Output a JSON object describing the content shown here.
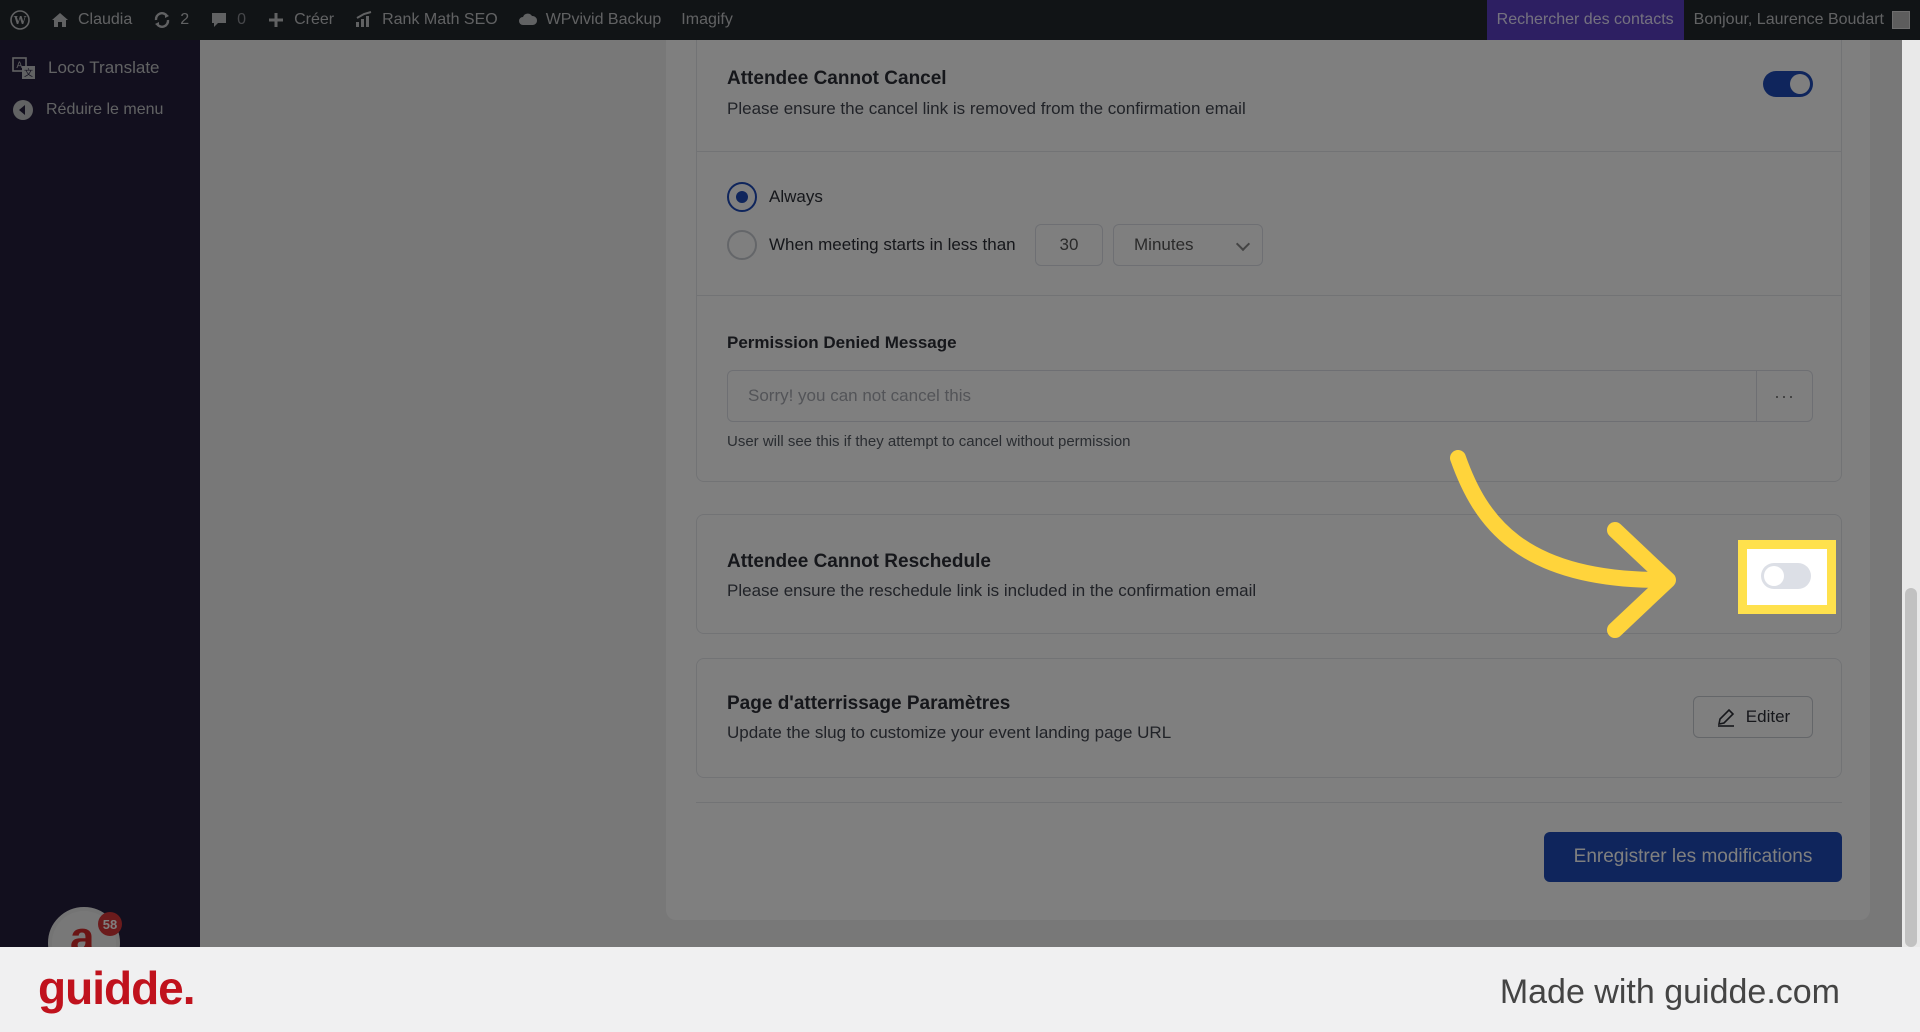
{
  "admin_bar": {
    "site_name": "Claudia",
    "updates_count": "2",
    "comments_count": "0",
    "create_label": "Créer",
    "rank_math_label": "Rank Math SEO",
    "backup_label": "WPvivid Backup",
    "imagify_label": "Imagify",
    "search_contacts_label": "Rechercher des contacts",
    "greeting": "Bonjour, Laurence Boudart"
  },
  "sidebar": {
    "items": [
      {
        "label": "Loco Translate",
        "icon": "translate-icon"
      },
      {
        "label": "Réduire le menu",
        "icon": "collapse-icon"
      }
    ],
    "notification_count": "58"
  },
  "settings": {
    "cancel": {
      "title": "Attendee Cannot Cancel",
      "description": "Please ensure the cancel link is removed from the confirmation email",
      "enabled": true
    },
    "cancel_options": {
      "always_label": "Always",
      "when_label": "When meeting starts in less than",
      "amount": "30",
      "unit": "Minutes",
      "selected": "always"
    },
    "permission": {
      "title": "Permission Denied Message",
      "placeholder": "Sorry! you can not cancel this",
      "more_label": "···",
      "help": "User will see this if they attempt to cancel without permission"
    },
    "reschedule": {
      "title": "Attendee Cannot Reschedule",
      "description": "Please ensure the reschedule link is included in the confirmation email",
      "enabled": false
    },
    "landing": {
      "title": "Page d'atterrissage Paramètres",
      "description": "Update the slug to customize your event landing page URL",
      "edit_label": "Editer"
    },
    "save_label": "Enregistrer les modifications"
  },
  "footer": {
    "brand": "guidde.",
    "made_with": "Made with guidde.com"
  },
  "colors": {
    "primary": "#1e4bb8",
    "highlight": "#ffe14d",
    "adminbar": "#23282d",
    "sidebar": "#241f3c",
    "brand": "#c0121d"
  }
}
